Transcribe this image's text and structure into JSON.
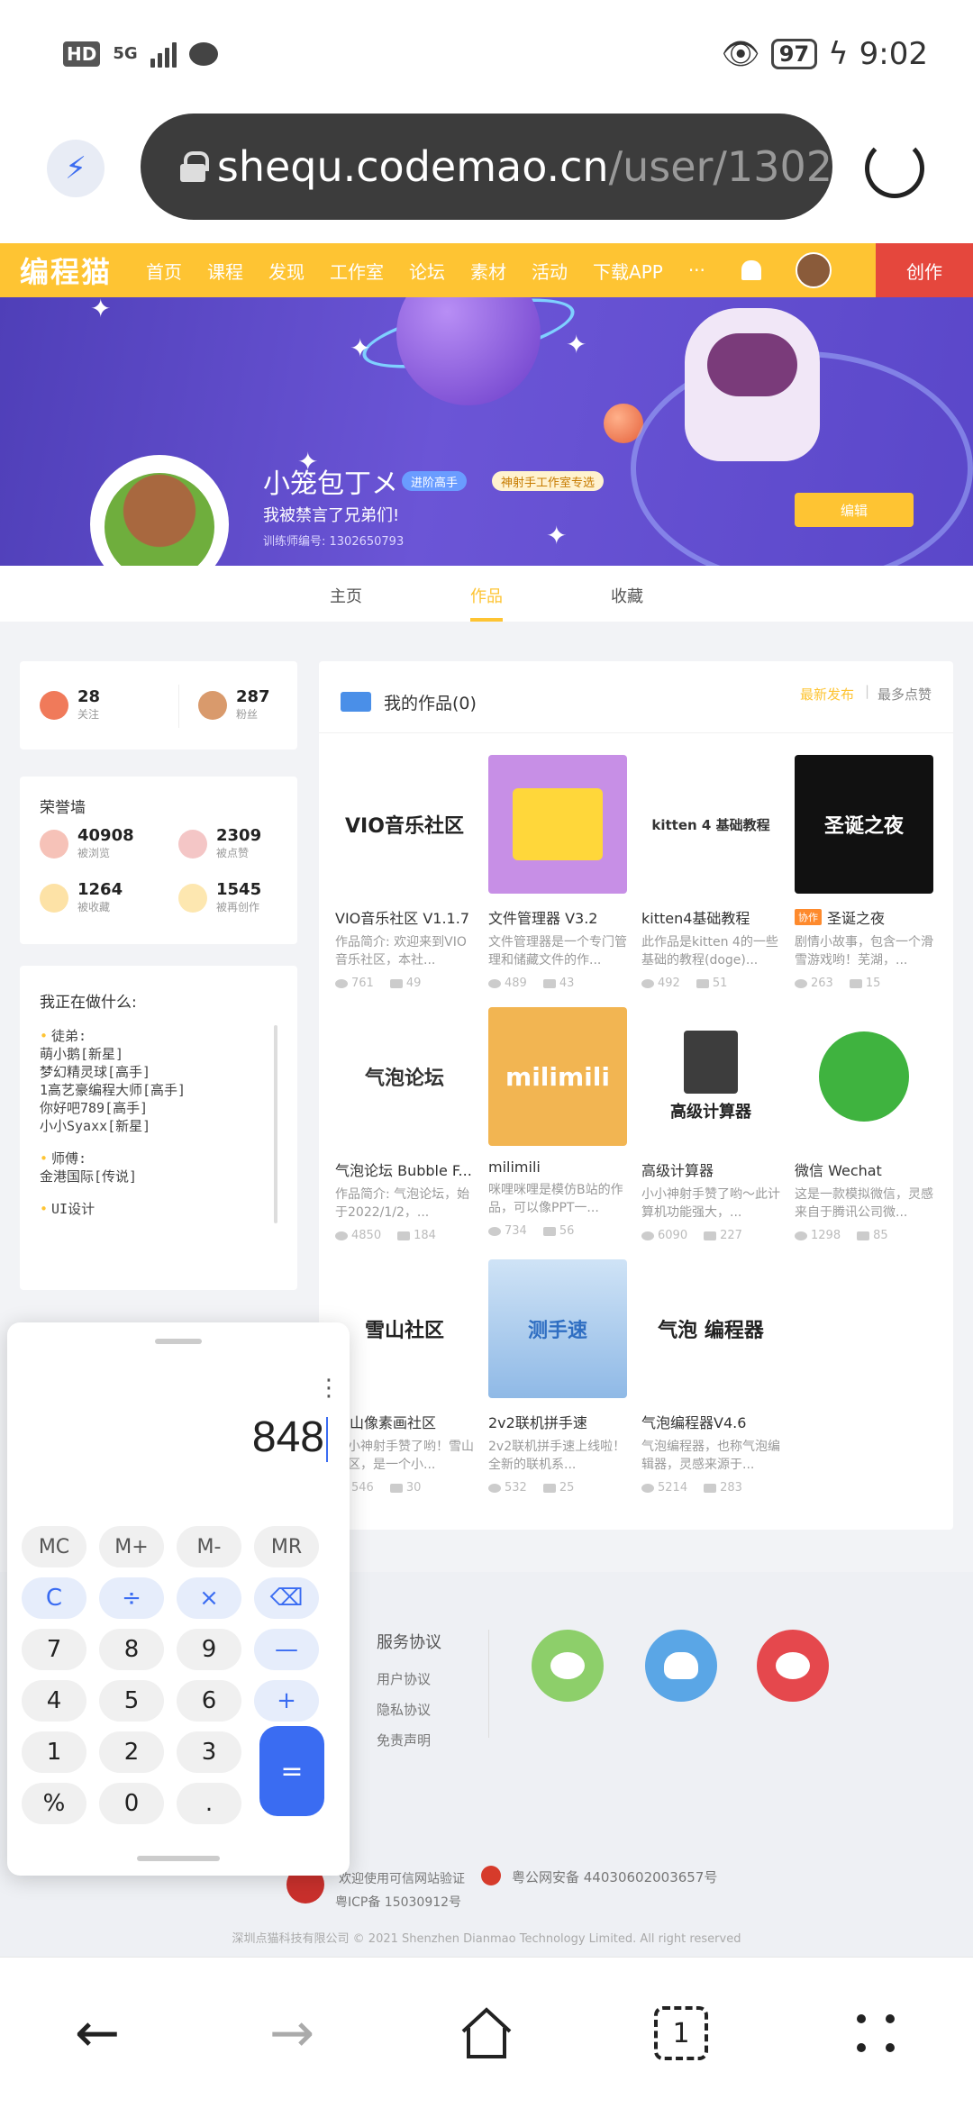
{
  "status": {
    "hd": "HD",
    "network": "5G",
    "battery": "97",
    "time": "9:02"
  },
  "browser": {
    "url_host": "shequ.codemao.cn",
    "url_path": "/user/1302"
  },
  "nav": {
    "logo": "编程猫",
    "items": [
      "首页",
      "课程",
      "发现",
      "工作室",
      "论坛",
      "素材",
      "活动",
      "下载APP"
    ],
    "more": "···",
    "create": "创作"
  },
  "profile": {
    "username": "小笼包丁メ",
    "badge_adv": "进阶高手",
    "badge_studio": "神射手工作室专选",
    "signature": "我被禁言了兄弟们!",
    "trainer_id": "训练师编号: 1302650793",
    "edit": "编辑",
    "tabs": [
      "主页",
      "作品",
      "收藏"
    ]
  },
  "follow": {
    "following": {
      "num": "28",
      "label": "关注"
    },
    "fans": {
      "num": "287",
      "label": "粉丝"
    }
  },
  "honor": {
    "title": "荣誉墙",
    "items": [
      {
        "num": "40908",
        "label": "被浏览"
      },
      {
        "num": "2309",
        "label": "被点赞"
      },
      {
        "num": "1264",
        "label": "被收藏"
      },
      {
        "num": "1545",
        "label": "被再创作"
      }
    ]
  },
  "doing": {
    "title": "我正在做什么:",
    "sections": [
      {
        "head": "徒弟:",
        "lines": [
          "萌小鹅[新星]",
          "梦幻精灵球[高手]",
          "1高艺豪编程大师[高手]",
          "你好吧789[高手]",
          "小小Syaxx[新星]"
        ]
      },
      {
        "head": "师傅:",
        "lines": [
          "金港国际[传说]"
        ]
      },
      {
        "head": "UI设计",
        "lines": []
      }
    ]
  },
  "works": {
    "title": "我的作品(0)",
    "sort_new": "最新发布",
    "sort_sep": "|",
    "sort_like": "最多点赞",
    "items": [
      {
        "title": "VIO音乐社区 V1.1.7",
        "desc": "作品简介: 欢迎来到VIO音乐社区，本社...",
        "views": "761",
        "likes": "49",
        "thumb": "VIO音乐社区",
        "tag": ""
      },
      {
        "title": "文件管理器 V3.2",
        "desc": "文件管理器是一个专门管理和储藏文件的作...",
        "views": "489",
        "likes": "43",
        "thumb": "",
        "tag": ""
      },
      {
        "title": "kitten4基础教程",
        "desc": "此作品是kitten 4的一些基础的教程(doge)...",
        "views": "492",
        "likes": "51",
        "thumb": "kitten 4 基础教程",
        "tag": ""
      },
      {
        "title": "圣诞之夜",
        "desc": "剧情小故事，包含一个滑雪游戏哟！芜湖，...",
        "views": "263",
        "likes": "15",
        "thumb": "圣诞之夜",
        "tag": "协作"
      },
      {
        "title": "气泡论坛 Bubble F...",
        "desc": "作品简介: 气泡论坛，始于2022/1/2，...",
        "views": "4850",
        "likes": "184",
        "thumb": "气泡论坛",
        "tag": ""
      },
      {
        "title": "milimili",
        "desc": "咪哩咪哩是模仿B站的作品，可以像PPT一...",
        "views": "734",
        "likes": "56",
        "thumb": "milimili",
        "tag": ""
      },
      {
        "title": "高级计算器",
        "desc": "小小神射手赞了哟～此计算机功能强大，...",
        "views": "6090",
        "likes": "227",
        "thumb": "高级计算器",
        "tag": ""
      },
      {
        "title": "微信 Wechat",
        "desc": "这是一款模拟微信，灵感来自于腾讯公司微...",
        "views": "1298",
        "likes": "85",
        "thumb": "",
        "tag": ""
      },
      {
        "title": "雪山像素画社区",
        "desc": "小小神射手赞了哟！雪山社区，是一个小...",
        "views": "546",
        "likes": "30",
        "thumb": "雪山社区",
        "tag": ""
      },
      {
        "title": "2v2联机拼手速",
        "desc": "2v2联机拼手速上线啦！全新的联机系...",
        "views": "532",
        "likes": "25",
        "thumb": "测手速",
        "tag": ""
      },
      {
        "title": "气泡编程器V4.6",
        "desc": "气泡编程器，也称气泡编辑器，灵感来源于...",
        "views": "5214",
        "likes": "283",
        "thumb": "气泡 编程器",
        "tag": ""
      }
    ]
  },
  "footer": {
    "service_title": "服务协议",
    "links": [
      "用户协议",
      "隐私协议",
      "免责声明"
    ],
    "verify": "欢迎使用可信网站验证",
    "icp": "粤ICP备 15030912号",
    "police": "粤公网安备 44030602003657号",
    "copyright": "深圳点猫科技有限公司 © 2021 Shenzhen Dianmao Technology Limited. All right reserved"
  },
  "calculator": {
    "display": "848",
    "menu": "⋮",
    "keys": {
      "mc": "MC",
      "mplus": "M+",
      "mminus": "M-",
      "mr": "MR",
      "clear": "C",
      "divide": "÷",
      "multiply": "×",
      "backspace": "⌫",
      "seven": "7",
      "eight": "8",
      "nine": "9",
      "minus": "—",
      "four": "4",
      "five": "5",
      "six": "6",
      "plus": "+",
      "one": "1",
      "two": "2",
      "three": "3",
      "percent": "%",
      "zero": "0",
      "dot": ".",
      "equals": "="
    }
  },
  "bottom_nav": {
    "back": "←",
    "forward": "→",
    "tabs": "1"
  },
  "colors": {
    "brand": "#fec433",
    "create": "#e5473d",
    "calc_accent": "#3a6cf2"
  }
}
